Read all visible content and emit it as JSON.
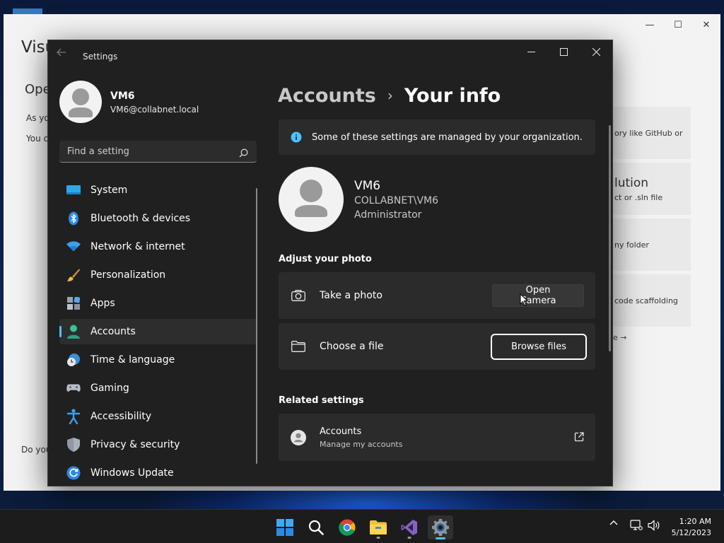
{
  "background_window": {
    "title": "Visu",
    "open_heading": "Ope",
    "lines": [
      "As yo",
      "You c",
      "Do you"
    ],
    "cards": [
      {
        "text": "ory like GitHub or"
      },
      {
        "title": "lution",
        "text": "ct or .sln file"
      },
      {
        "text": "ny folder"
      },
      {
        "text": "code scaffolding"
      }
    ],
    "more_link": "e →"
  },
  "settings": {
    "app_title": "Settings",
    "profile": {
      "name": "VM6",
      "email": "VM6@collabnet.local"
    },
    "search": {
      "placeholder": "Find a setting"
    },
    "nav": [
      {
        "label": "System",
        "icon": "system-icon"
      },
      {
        "label": "Bluetooth & devices",
        "icon": "bluetooth-icon"
      },
      {
        "label": "Network & internet",
        "icon": "wifi-icon"
      },
      {
        "label": "Personalization",
        "icon": "brush-icon"
      },
      {
        "label": "Apps",
        "icon": "apps-icon"
      },
      {
        "label": "Accounts",
        "icon": "accounts-icon",
        "active": true
      },
      {
        "label": "Time & language",
        "icon": "clock-globe-icon"
      },
      {
        "label": "Gaming",
        "icon": "gamepad-icon"
      },
      {
        "label": "Accessibility",
        "icon": "accessibility-icon"
      },
      {
        "label": "Privacy & security",
        "icon": "shield-icon"
      },
      {
        "label": "Windows Update",
        "icon": "update-icon"
      }
    ],
    "breadcrumb": {
      "parent": "Accounts",
      "separator": "›",
      "current": "Your info"
    },
    "info_message": "Some of these settings are managed by your organization.",
    "user": {
      "name": "VM6",
      "domain": "COLLABNET\\VM6",
      "role": "Administrator"
    },
    "adjust_photo_title": "Adjust your photo",
    "take_photo": {
      "label": "Take a photo",
      "button": "Open Camera"
    },
    "choose_file": {
      "label": "Choose a file",
      "button": "Browse files"
    },
    "related_title": "Related settings",
    "related_accounts": {
      "title": "Accounts",
      "subtitle": "Manage my accounts"
    }
  },
  "taskbar": {
    "apps": [
      "start-icon",
      "search-icon",
      "chrome-icon",
      "file-explorer-icon",
      "visual-studio-icon",
      "settings-icon"
    ],
    "clock": {
      "time": "1:20 AM",
      "date": "5/12/2023"
    }
  },
  "colors": {
    "accent": "#4cc2ff",
    "window_bg": "#202020",
    "card_bg": "#2b2b2b"
  }
}
